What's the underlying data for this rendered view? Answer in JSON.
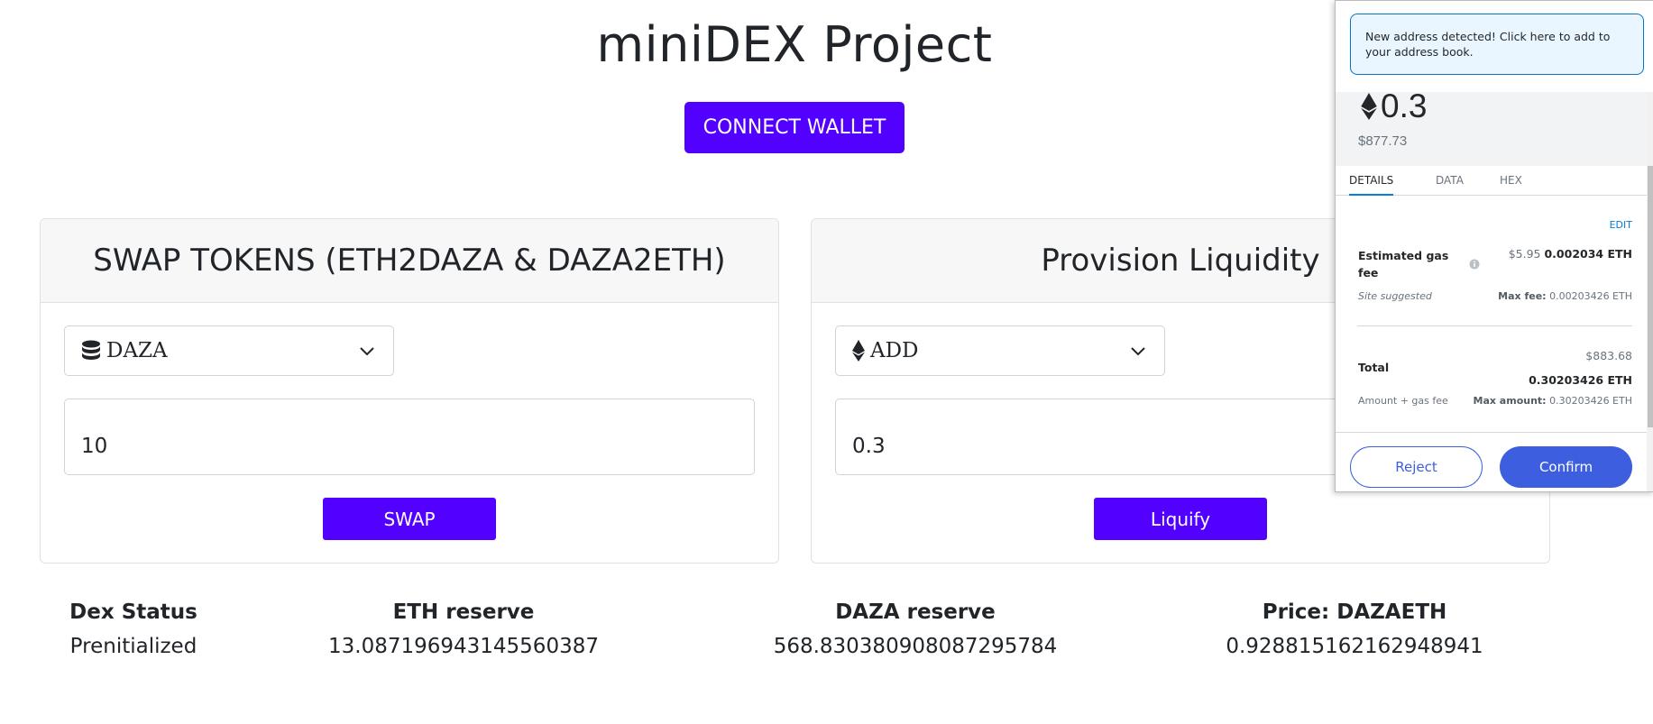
{
  "page": {
    "title": "miniDEX Project",
    "connect_label": "CONNECT WALLET"
  },
  "swap": {
    "header": "SWAP TOKENS (ETH2DAZA & DAZA2ETH)",
    "select_value": "DAZA",
    "select_icon": "database-icon",
    "amount": "10",
    "button_label": "SWAP"
  },
  "liquidity": {
    "header": "Provision Liquidity",
    "select_value": "ADD",
    "select_icon": "ethereum-icon",
    "amount": "0.3",
    "button_label": "Liquify"
  },
  "stats": [
    {
      "label": "Dex Status",
      "value": "Prenitialized"
    },
    {
      "label": "ETH reserve",
      "value": "13.087196943145560387"
    },
    {
      "label": "DAZA reserve",
      "value": "568.830380908087295784"
    },
    {
      "label": "Price: DAZAETH",
      "value": "0.928815162162948941"
    }
  ],
  "wallet": {
    "notice": "New address detected! Click here to add to your address book.",
    "amount": "0.3",
    "usd": "$877.73",
    "tabs": [
      "DETAILS",
      "DATA",
      "HEX"
    ],
    "edit": "EDIT",
    "gas_label": "Estimated gas fee",
    "gas_usd": "$5.95",
    "gas_eth": "0.002034 ETH",
    "site_suggested": "Site suggested",
    "max_fee_label": "Max fee:",
    "max_fee_value": "0.00203426 ETH",
    "total_usd": "$883.68",
    "total_label": "Total",
    "total_eth": "0.30203426 ETH",
    "amount_gas_label": "Amount + gas fee",
    "max_amount_label": "Max amount:",
    "max_amount_value": "0.30203426 ETH",
    "reject": "Reject",
    "confirm": "Confirm",
    "accent": "#3d5ede"
  },
  "colors": {
    "primary": "#5200ff"
  }
}
